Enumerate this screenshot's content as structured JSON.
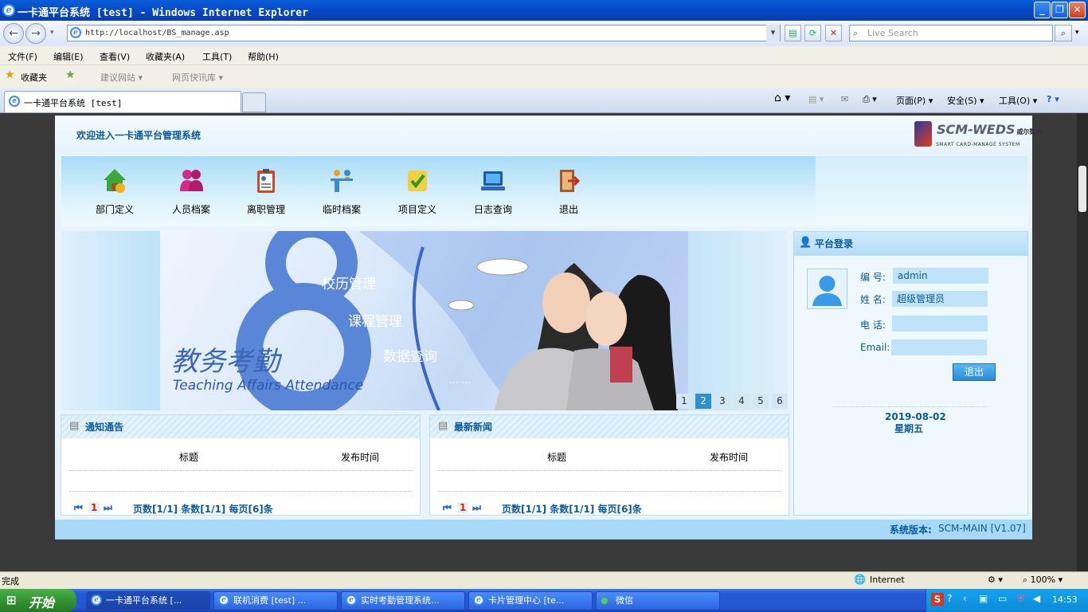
{
  "window": {
    "title": "一卡通平台系统 [test] - Windows Internet Explorer",
    "address": "http://localhost/BS_manage.asp",
    "search_placeholder": "Live Search"
  },
  "menu": [
    "文件(F)",
    "编辑(E)",
    "查看(V)",
    "收藏夹(A)",
    "工具(T)",
    "帮助(H)"
  ],
  "favorites": {
    "label": "收藏夹",
    "item1": "建议网站 ▾",
    "item2": "网页快讯库 ▾"
  },
  "tab": {
    "label": "一卡通平台系统 [test]"
  },
  "commands": {
    "page": "页面(P) ▾",
    "safety": "安全(S) ▾",
    "tools": "工具(O) ▾"
  },
  "app": {
    "welcome": "欢迎进入一卡通平台管理系统",
    "logo": {
      "name": "SCM-WEDS",
      "cn": "威尔数据",
      "subtitle": "SMART CARD-MANAGE SYSTEM"
    },
    "nav": [
      "部门定义",
      "人员档案",
      "离职管理",
      "临时档案",
      "项目定义",
      "日志查询",
      "退出"
    ],
    "banner": {
      "items": [
        "校历管理",
        "课程管理",
        "数据查询",
        "... ..."
      ],
      "title_cn": "教务考勤",
      "title_en": "Teaching Affairs Attendance",
      "pages": [
        "1",
        "2",
        "3",
        "4",
        "5",
        "6"
      ],
      "active_page": 2
    },
    "notices": {
      "title": "通知通告",
      "col_title": "标题",
      "col_time": "发布时间",
      "page_num": "1",
      "pager": "页数[1/1] 条数[1/1] 每页[6]条"
    },
    "news": {
      "title": "最新新闻",
      "col_title": "标题",
      "col_time": "发布时间",
      "page_num": "1",
      "pager": "页数[1/1] 条数[1/1] 每页[6]条"
    },
    "login": {
      "title": "平台登录",
      "id_label": "编  号:",
      "id_value": "admin",
      "name_label": "姓  名:",
      "name_value": "超级管理员",
      "phone_label": "电  话:",
      "phone_value": "",
      "email_label": "Email:",
      "email_value": "",
      "logout": "退出",
      "date": "2019-08-02",
      "weekday": "星期五"
    },
    "footer": {
      "label": "系统版本:",
      "version": "SCM-MAIN [V1.07]"
    }
  },
  "status": {
    "text": "完成",
    "zone": "Internet",
    "zoom": "100%"
  },
  "taskbar": {
    "start": "开始",
    "tasks": [
      "一卡通平台系统 [...",
      "联机消费 [test] ...",
      "实时考勤管理系统...",
      "卡片管理中心 [te...",
      "微信"
    ],
    "clock": "14:53"
  },
  "colors": {
    "accent": "#0a5a9c",
    "banner_blue": "#2f8fd0"
  }
}
